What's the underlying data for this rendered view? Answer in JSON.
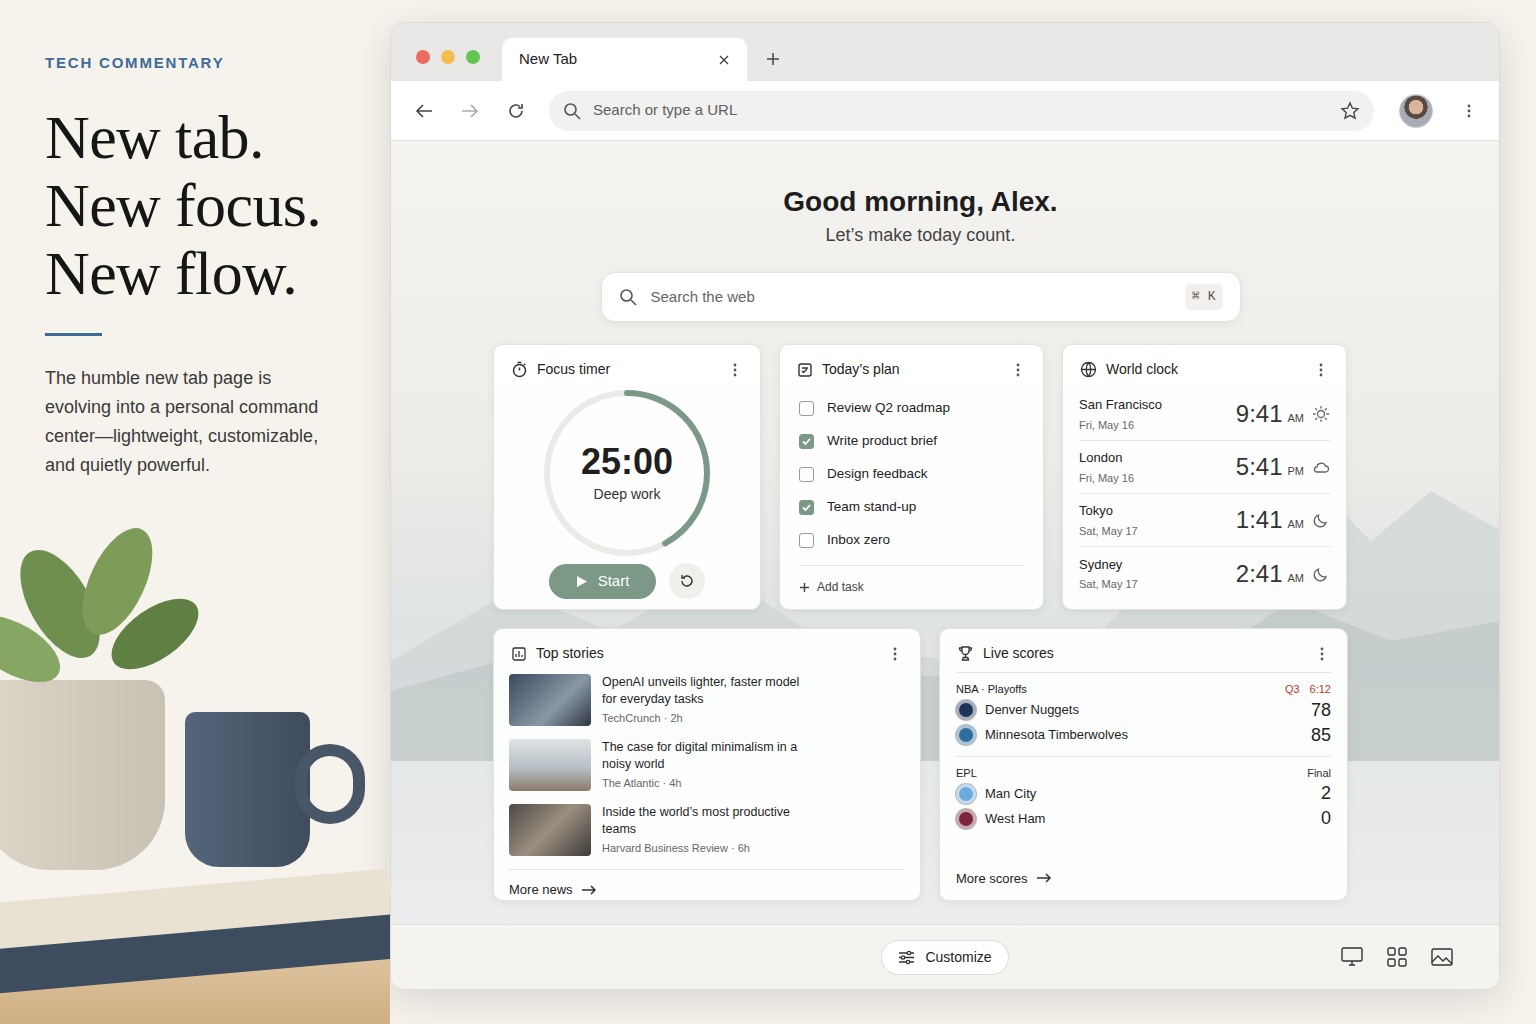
{
  "page": {
    "kicker": "TECH COMMENTARY",
    "headline": [
      "New tab.",
      "New focus.",
      "New flow."
    ],
    "body": "The humble new tab page is evolving into a personal command center—lightweight, customizable, and quietly powerful."
  },
  "window": {
    "tabs": [
      {
        "label": "New Tab",
        "selected": true
      }
    ],
    "address": {
      "placeholder": "Search or type a URL"
    }
  },
  "greeting": {
    "title": "Good morning, Alex.",
    "subtitle": "Let’s make today count."
  },
  "search": {
    "placeholder": "Search the web",
    "shortcut": "⌘ K"
  },
  "focus_timer": {
    "title": "Focus timer",
    "time": "25:00",
    "label": "Deep work",
    "level": 0.42,
    "start": "Start"
  },
  "plan": {
    "title": "Today’s plan",
    "tasks": [
      {
        "label": "Review Q2 roadmap",
        "checked": false
      },
      {
        "label": "Write product brief",
        "checked": true
      },
      {
        "label": "Design feedback",
        "checked": false
      },
      {
        "label": "Team stand-up",
        "checked": true
      },
      {
        "label": "Inbox zero",
        "checked": false
      }
    ],
    "add": "Add task"
  },
  "world_clock": {
    "title": "World clock",
    "cities": [
      {
        "city": "San Francisco",
        "date": "Fri, May 16",
        "time": "9:41",
        "period": "AM",
        "kind": "sun"
      },
      {
        "city": "London",
        "date": "Fri, May 16",
        "time": "5:41",
        "period": "PM",
        "kind": "cloud"
      },
      {
        "city": "Tokyo",
        "date": "Sat, May 17",
        "time": "1:41",
        "period": "AM",
        "kind": "moon"
      },
      {
        "city": "Sydney",
        "date": "Sat, May 17",
        "time": "2:41",
        "period": "AM",
        "kind": "moon"
      }
    ]
  },
  "top_stories": {
    "title": "Top stories",
    "stories": [
      {
        "title": "OpenAI unveils lighter, faster model for everyday tasks",
        "source": "TechCrunch · 2h"
      },
      {
        "title": "The case for digital minimalism in a noisy world",
        "source": "The Atlantic · 4h"
      },
      {
        "title": "Inside the world’s most productive teams",
        "source": "Harvard Business Review · 6h"
      }
    ],
    "more": "More news"
  },
  "live_scores": {
    "title": "Live scores",
    "games": [
      {
        "league": "NBA · Playoffs",
        "status": "Q3",
        "clock": "6:12",
        "live": true,
        "teams": [
          {
            "name": "Denver Nuggets",
            "score": "78",
            "color": "#1d3557"
          },
          {
            "name": "Minnesota Timberwolves",
            "score": "85",
            "color": "#2f6f9f"
          }
        ]
      },
      {
        "league": "EPL",
        "status": "Final",
        "live": false,
        "teams": [
          {
            "name": "Man City",
            "score": "2",
            "color": "#6cabdd"
          },
          {
            "name": "West Ham",
            "score": "0",
            "color": "#7a263a"
          }
        ]
      }
    ],
    "more": "More scores"
  },
  "footer": {
    "customize": "Customize"
  }
}
